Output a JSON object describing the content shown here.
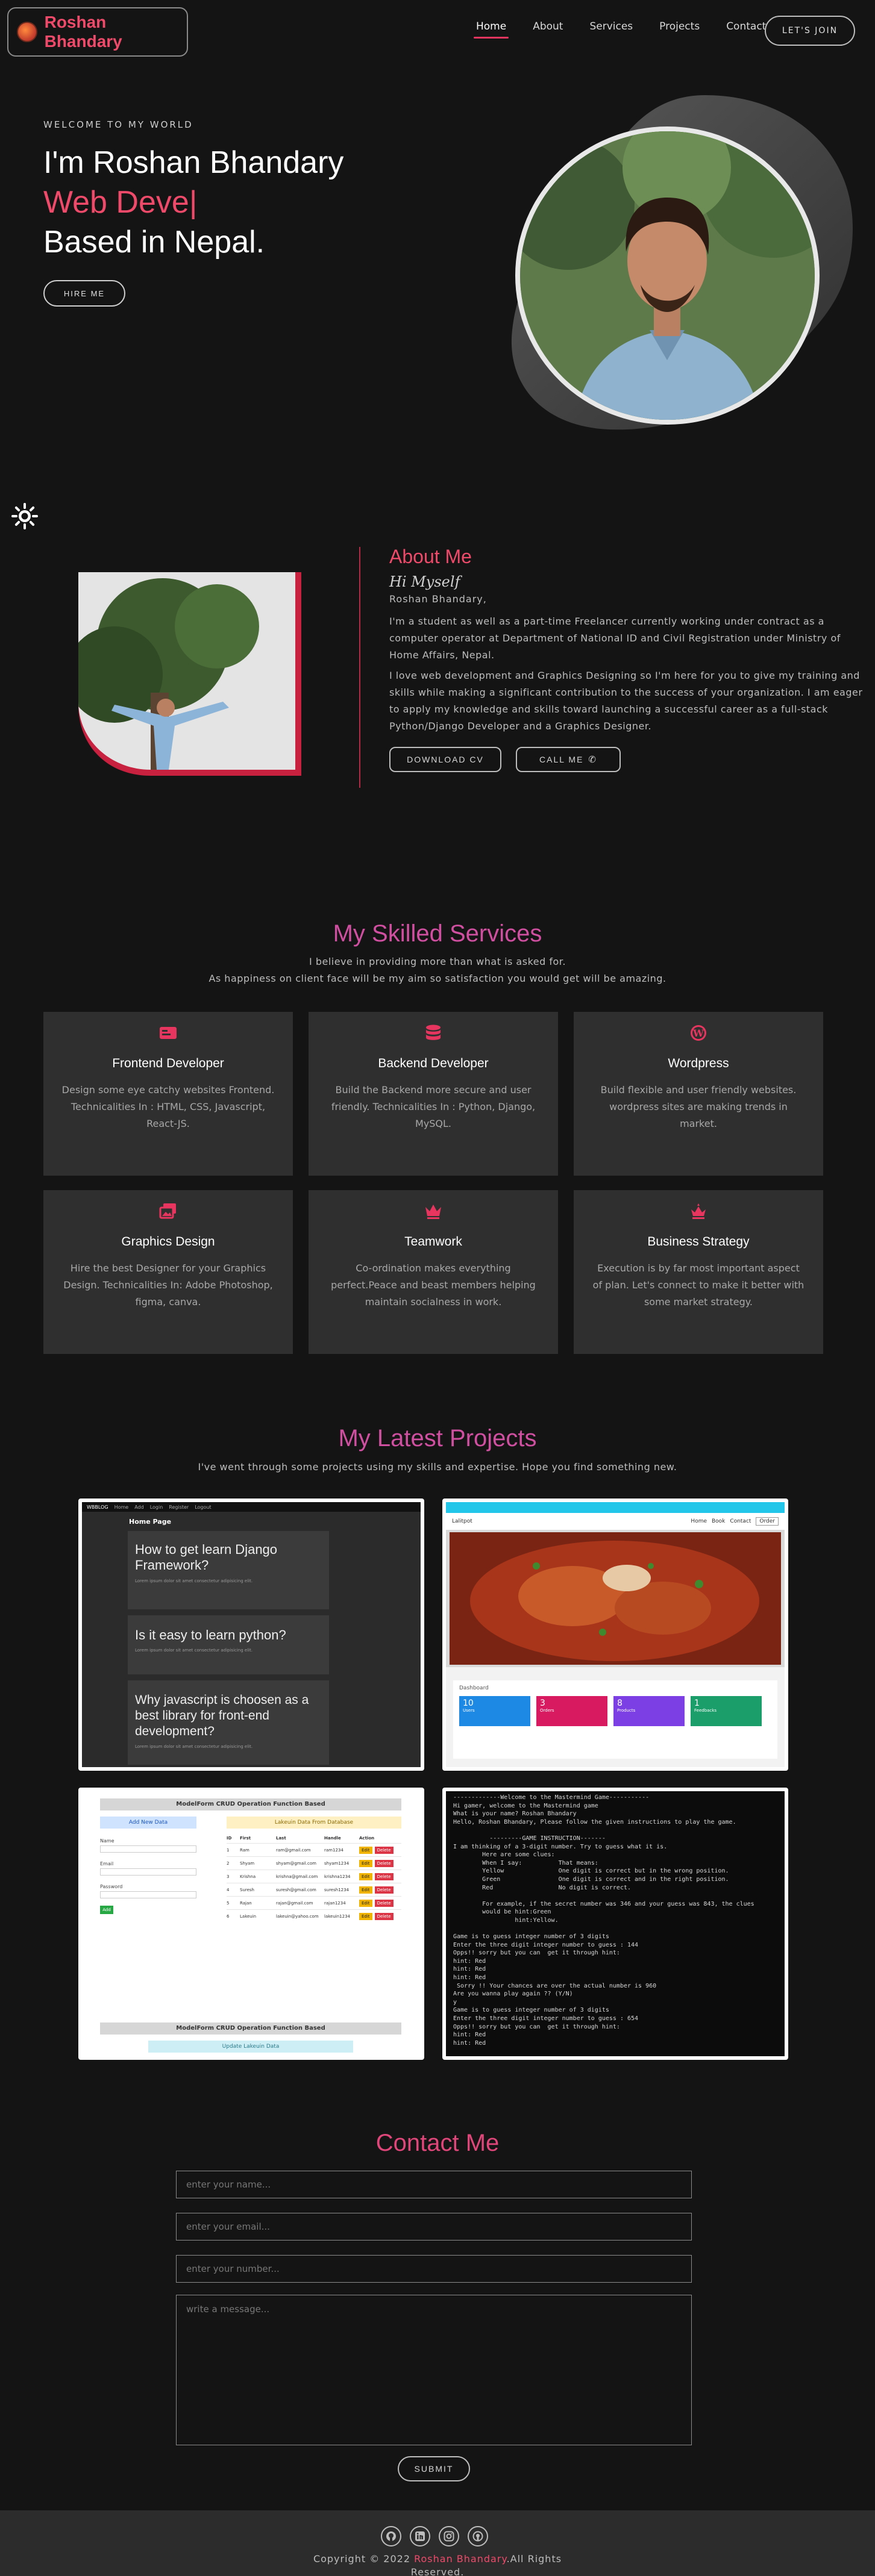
{
  "nav": {
    "brand": "Roshan Bhandary",
    "links": [
      {
        "label": "Home",
        "active": true
      },
      {
        "label": "About",
        "active": false
      },
      {
        "label": "Services",
        "active": false
      },
      {
        "label": "Projects",
        "active": false
      },
      {
        "label": "Contact",
        "active": false
      }
    ],
    "join_label": "LET'S JOIN"
  },
  "hero": {
    "welcome": "WELCOME TO MY WORLD",
    "line1": "I'm Roshan Bhandary",
    "line2": "Web Deve|",
    "line3": "Based in Nepal.",
    "hire_label": "HIRE ME"
  },
  "theme_toggle_icon": "sun-icon",
  "about": {
    "title": "About Me",
    "hi": "Hi Myself",
    "name": "Roshan Bhandary,",
    "p1": "I'm a student as well as a part-time Freelancer currently working under contract as a computer operator at Department of National ID and Civil Registration under Ministry of Home Affairs, Nepal.",
    "p2": "I love web development and Graphics Designing so I'm here for you to give my training and skills while making a significant contribution to the success of your organization. I am eager to apply my knowledge and skills toward launching a successful career as a full-stack Python/Django Developer and a Graphics Designer.",
    "download_label": "DOWNLOAD CV",
    "call_label": "CALL ME"
  },
  "services": {
    "title": "My Skilled Services",
    "subtitle1": "I believe in providing more than what is asked for.",
    "subtitle2": "As happiness on client face will be my aim so satisfaction you would get will be amazing.",
    "items": [
      {
        "title": "Frontend Developer",
        "desc": "Design some eye catchy websites Frontend. Technicalities In : HTML, CSS, Javascript, React-JS.",
        "icon": "id-card-icon"
      },
      {
        "title": "Backend Developer",
        "desc": "Build the Backend more secure and user friendly. Technicalities In : Python, Django, MySQL.",
        "icon": "database-icon"
      },
      {
        "title": "Wordpress",
        "desc": "Build flexible and user friendly websites. wordpress sites are making trends in market.",
        "icon": "wordpress-icon"
      },
      {
        "title": "Graphics Design",
        "desc": "Hire the best Designer for your Graphics Design. Technicalities In: Adobe Photoshop, figma, canva.",
        "icon": "images-icon"
      },
      {
        "title": "Teamwork",
        "desc": "Co-ordination makes everything perfect.Peace and beast members helping maintain socialness in work.",
        "icon": "crown-icon"
      },
      {
        "title": "Business Strategy",
        "desc": "Execution is by far most important aspect of plan. Let's connect to make it better with some market strategy.",
        "icon": "crown-icon"
      }
    ],
    "accent": "#e8355f"
  },
  "projects": {
    "title": "My Latest Projects",
    "subtitle": "I've went through some projects using my skills and expertise. Hope you find something new.",
    "django": {
      "nav_brand": "WBBLOG",
      "nav_links": [
        "Home",
        "Add",
        "Login",
        "Register",
        "Logout"
      ],
      "page_title": "Home Page",
      "posts": [
        "How to get learn Django Framework?",
        "Is it easy to learn python?",
        "Why javascript is choosen as a best library for front-end development?"
      ],
      "lorem": "Lorem ipsum dolor sit amet consectetur adipisicing elit."
    },
    "restaurant": {
      "brand": "Lalitpot",
      "nav_links": [
        "Home",
        "Book",
        "Contact"
      ],
      "btn": "Order",
      "dashboard": "Dashboard",
      "stats": [
        {
          "value": "10",
          "label": "Users",
          "color": "#1e88e5"
        },
        {
          "value": "3",
          "label": "Orders",
          "color": "#d81b60"
        },
        {
          "value": "8",
          "label": "Products",
          "color": "#7b3fe4"
        },
        {
          "value": "1",
          "label": "Feedbacks",
          "color": "#1b9e6a"
        }
      ]
    },
    "crud": {
      "title": "ModelForm CRUD Operation Function Based",
      "add_header": "Add New Data",
      "list_header": "Lakeuin Data From Database",
      "labels": [
        "Name",
        "Email",
        "Password"
      ],
      "add_btn": "Add",
      "columns": [
        "ID",
        "First",
        "Last",
        "Handle",
        "Action"
      ],
      "rows": [
        [
          "1",
          "Ram",
          "ram@gmail.com",
          "ram1234"
        ],
        [
          "2",
          "Shyam",
          "shyam@gmail.com",
          "shyam1234"
        ],
        [
          "3",
          "Krishna",
          "krishna@gmail.com",
          "krishna1234"
        ],
        [
          "4",
          "Suresh",
          "suresh@gmail.com",
          "suresh1234"
        ],
        [
          "5",
          "Rajan",
          "rajan@gmail.com",
          "rajan1234"
        ],
        [
          "6",
          "Lakeuin",
          "lakeuin@yahoo.com",
          "lakeuin1234"
        ]
      ],
      "edit_btn": "Edit",
      "delete_btn": "Delete",
      "footer_title": "ModelForm CRUD Operation Function Based",
      "update_label": "Update Lakeuin Data"
    },
    "terminal": {
      "lines": [
        "-------------Welcome to the Mastermind Game-----------",
        "Hi gamer, welcome to the Mastermind game",
        "What is your name? Roshan Bhandary",
        "Hello, Roshan Bhandary, Please follow the given instructions to play the game.",
        "",
        "          ---------GAME INSTRUCTION-------",
        "I am thinking of a 3-digit number. Try to guess what it is.",
        "        Here are some clues:",
        "        When I say:          That means:",
        "        Yellow               One digit is correct but in the wrong position.",
        "        Green                One digit is correct and in the right position.",
        "        Red                  No digit is correct.",
        "",
        "        For example, if the secret number was 346 and your guess was 843, the clues",
        "        would be hint:Green",
        "                 hint:Yellow.",
        "",
        "Game is to guess integer number of 3 digits",
        "Enter the three digit integer number to guess : 144",
        "Opps!! sorry but you can  get it through hint:",
        "hint: Red",
        "hint: Red",
        "hint: Red",
        " Sorry !! Your chances are over the actual number is 960",
        "Are you wanna play again ?? (Y/N)",
        "y",
        "Game is to guess integer number of 3 digits",
        "Enter the three digit integer number to guess : 654",
        "Opps!! sorry but you can  get it through hint:",
        "hint: Red",
        "hint: Red"
      ]
    }
  },
  "contact": {
    "title": "Contact Me",
    "name_placeholder": "enter your name...",
    "email_placeholder": "enter your email...",
    "number_placeholder": "enter your number...",
    "message_placeholder": "write a message...",
    "submit_label": "SUBMIT"
  },
  "footer": {
    "copyright_prefix": "Copyright © 2022 ",
    "copyright_name": "Roshan Bhandary",
    "copyright_suffix": ".All Rights",
    "reserved": "Reserved.",
    "socials": [
      "github-icon",
      "linkedin-icon",
      "instagram-icon",
      "github-alt-icon"
    ]
  }
}
